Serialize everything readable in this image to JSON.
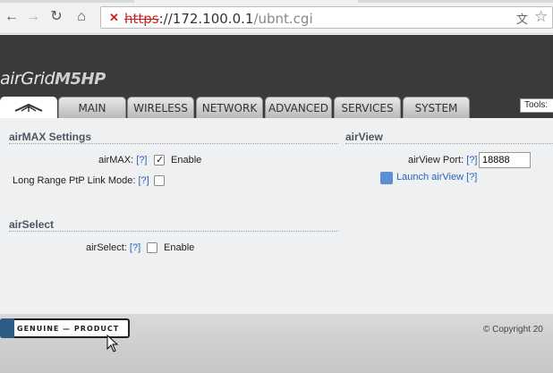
{
  "browser": {
    "url_scheme": "https",
    "url_host": "://172.100.0.1",
    "url_path": "/ubnt.cgi"
  },
  "brand": {
    "logo_text": "airGrid",
    "model": "M5HP"
  },
  "tabs": [
    {
      "label": "MAIN"
    },
    {
      "label": "WIRELESS"
    },
    {
      "label": "NETWORK"
    },
    {
      "label": "ADVANCED"
    },
    {
      "label": "SERVICES"
    },
    {
      "label": "SYSTEM"
    }
  ],
  "tools_label": "Tools:",
  "airmax": {
    "title": "airMAX Settings",
    "airmax_label": "airMAX:",
    "airmax_help": "[?]",
    "airmax_enable": "Enable",
    "airmax_checked": true,
    "ptp_label": "Long Range PtP Link Mode:",
    "ptp_help": "[?]",
    "ptp_checked": false
  },
  "airselect": {
    "title": "airSelect",
    "label": "airSelect:",
    "help": "[?]",
    "enable": "Enable",
    "checked": false
  },
  "airview": {
    "title": "airView",
    "port_label": "airView Port:",
    "port_help": "[?]",
    "port_value": "18888",
    "launch_label": "Launch airView",
    "launch_help": "[?]"
  },
  "footer": {
    "badge_text": "GENUINE  —  PRODUCT",
    "copyright": "© Copyright 20"
  },
  "colors": {
    "header": "#3a3a3a",
    "link": "#2a63b8",
    "content_bg": "#eef0f2"
  }
}
